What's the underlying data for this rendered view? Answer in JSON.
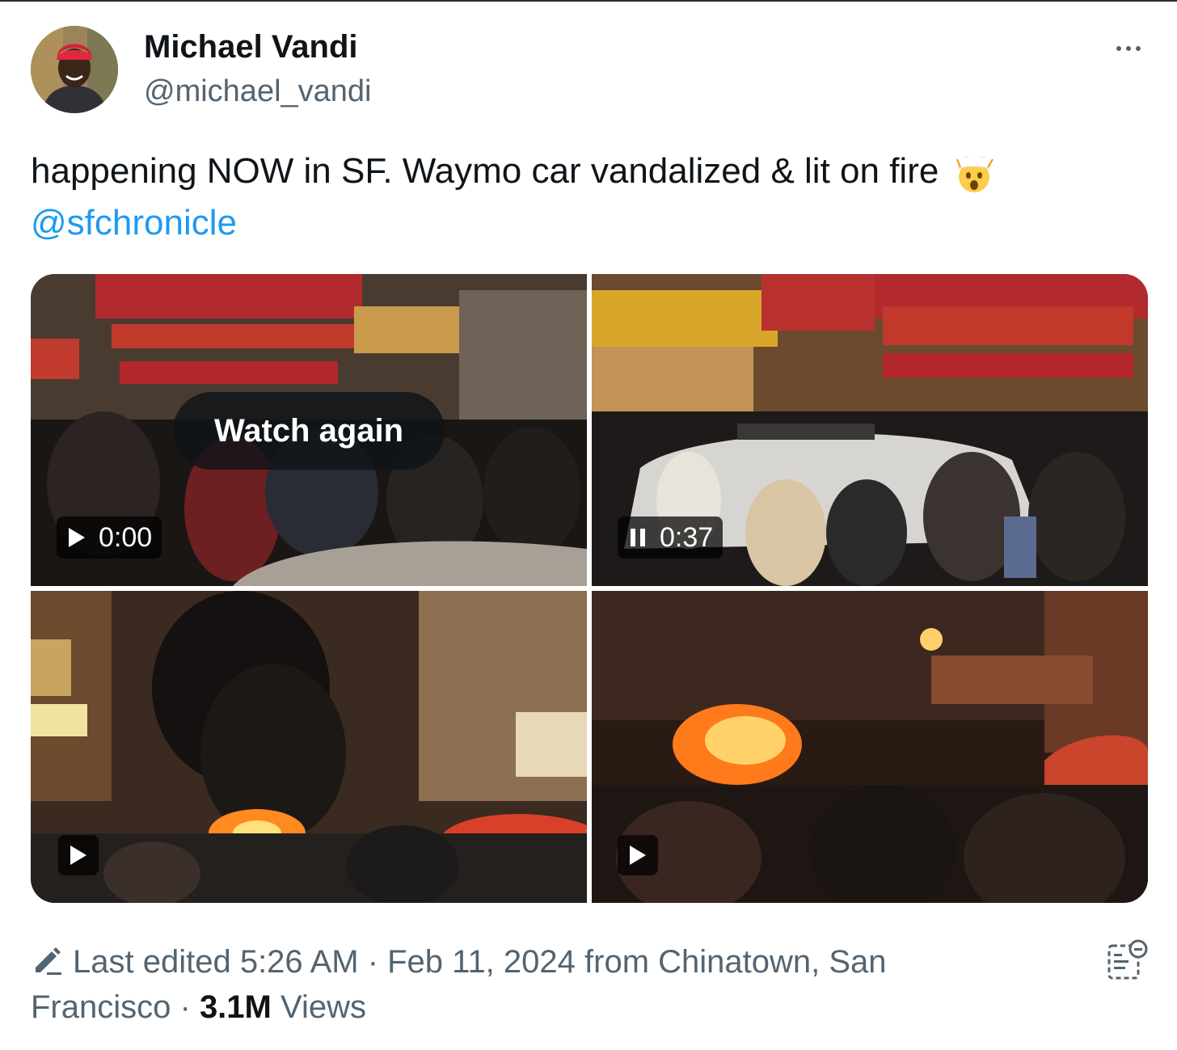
{
  "author": {
    "display_name": "Michael Vandi",
    "handle": "@michael_vandi",
    "avatar": "avatar-photo"
  },
  "tweet": {
    "text": "happening NOW in SF. Waymo car vandalized & lit on fire",
    "emoji": "exploding-head-emoji",
    "mention": "@sfchronicle"
  },
  "media": [
    {
      "kind": "video",
      "overlay_label": "Watch again",
      "time": "0:00",
      "control": "play-icon"
    },
    {
      "kind": "video",
      "time": "0:37",
      "control": "pause-icon"
    },
    {
      "kind": "video",
      "control": "play-icon"
    },
    {
      "kind": "video",
      "control": "play-icon"
    }
  ],
  "meta": {
    "edited_text": "Last edited 5:26 AM · Feb 11, 2024 from Chinatown, San Francisco · ",
    "views_count": "3.1M",
    "views_label": " Views"
  },
  "icons": {
    "more": "more-options-icon",
    "edit": "pencil-icon",
    "notes": "community-notes-icon"
  },
  "colors": {
    "link": "#1d9bf0",
    "secondary_text": "#536471",
    "primary_text": "#0f1419"
  }
}
